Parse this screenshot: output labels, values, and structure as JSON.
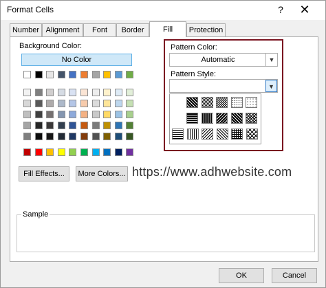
{
  "window": {
    "title": "Format Cells",
    "help": "?",
    "close": "✕"
  },
  "tabs": [
    {
      "label": "Number"
    },
    {
      "label": "Alignment"
    },
    {
      "label": "Font"
    },
    {
      "label": "Border"
    },
    {
      "label": "Fill",
      "active": true
    },
    {
      "label": "Protection"
    }
  ],
  "fill": {
    "background_color_label": "Background Color:",
    "no_color_label": "No Color",
    "fill_effects_label": "Fill Effects...",
    "more_colors_label": "More Colors...",
    "pattern_color_label": "Pattern Color:",
    "pattern_color_value": "Automatic",
    "pattern_style_label": "Pattern Style:",
    "pattern_style_value": "",
    "sample_label": "Sample"
  },
  "watermark": "https://www.adhwebsite.com",
  "buttons": {
    "ok": "OK",
    "cancel": "Cancel"
  },
  "palette": {
    "theme_top": [
      "#ffffff",
      "#000000",
      "#e7e6e6",
      "#44546a",
      "#4472c4",
      "#ed7d31",
      "#a5a5a5",
      "#ffc000",
      "#5b9bd5",
      "#70ad47"
    ],
    "theme_shades": [
      [
        "#f2f2f2",
        "#7f7f7f",
        "#d0cece",
        "#d6dce4",
        "#d9e2f3",
        "#fbe5d5",
        "#ededed",
        "#fff2cc",
        "#deebf6",
        "#e2efd9"
      ],
      [
        "#d8d8d8",
        "#595959",
        "#aeabab",
        "#adb9ca",
        "#b4c6e7",
        "#f7cbac",
        "#dbdbdb",
        "#fee599",
        "#bdd7ee",
        "#c5e0b3"
      ],
      [
        "#bfbfbf",
        "#3f3f3f",
        "#757070",
        "#8496b0",
        "#8eaadb",
        "#f4b183",
        "#c9c9c9",
        "#ffd965",
        "#9cc3e5",
        "#a8d08d"
      ],
      [
        "#a5a5a5",
        "#262626",
        "#3a3838",
        "#323f4f",
        "#2f5496",
        "#c55a11",
        "#7b7b7b",
        "#bf9000",
        "#2e75b5",
        "#538135"
      ],
      [
        "#7f7f7f",
        "#0c0c0c",
        "#171616",
        "#222a35",
        "#1f3864",
        "#833c0b",
        "#525252",
        "#7f6000",
        "#1e4e79",
        "#375623"
      ]
    ],
    "standard": [
      "#c00000",
      "#ff0000",
      "#ffc000",
      "#ffff00",
      "#92d050",
      "#00b050",
      "#00b0f0",
      "#0070c0",
      "#002060",
      "#7030a0"
    ]
  },
  "pattern_styles": [
    [
      "solid-75",
      "solid-50",
      "grey-25",
      "grey-12",
      "grey-6"
    ],
    [
      "horizontal-stripe",
      "vertical-stripe",
      "reverse-diagonal-stripe",
      "diagonal-stripe",
      "diagonal-crosshatch"
    ],
    [
      "thin-horizontal",
      "thin-vertical",
      "thin-reverse-diagonal",
      "thin-diagonal",
      "thin-crosshatch",
      "thin-diagonal-crosshatch"
    ]
  ]
}
